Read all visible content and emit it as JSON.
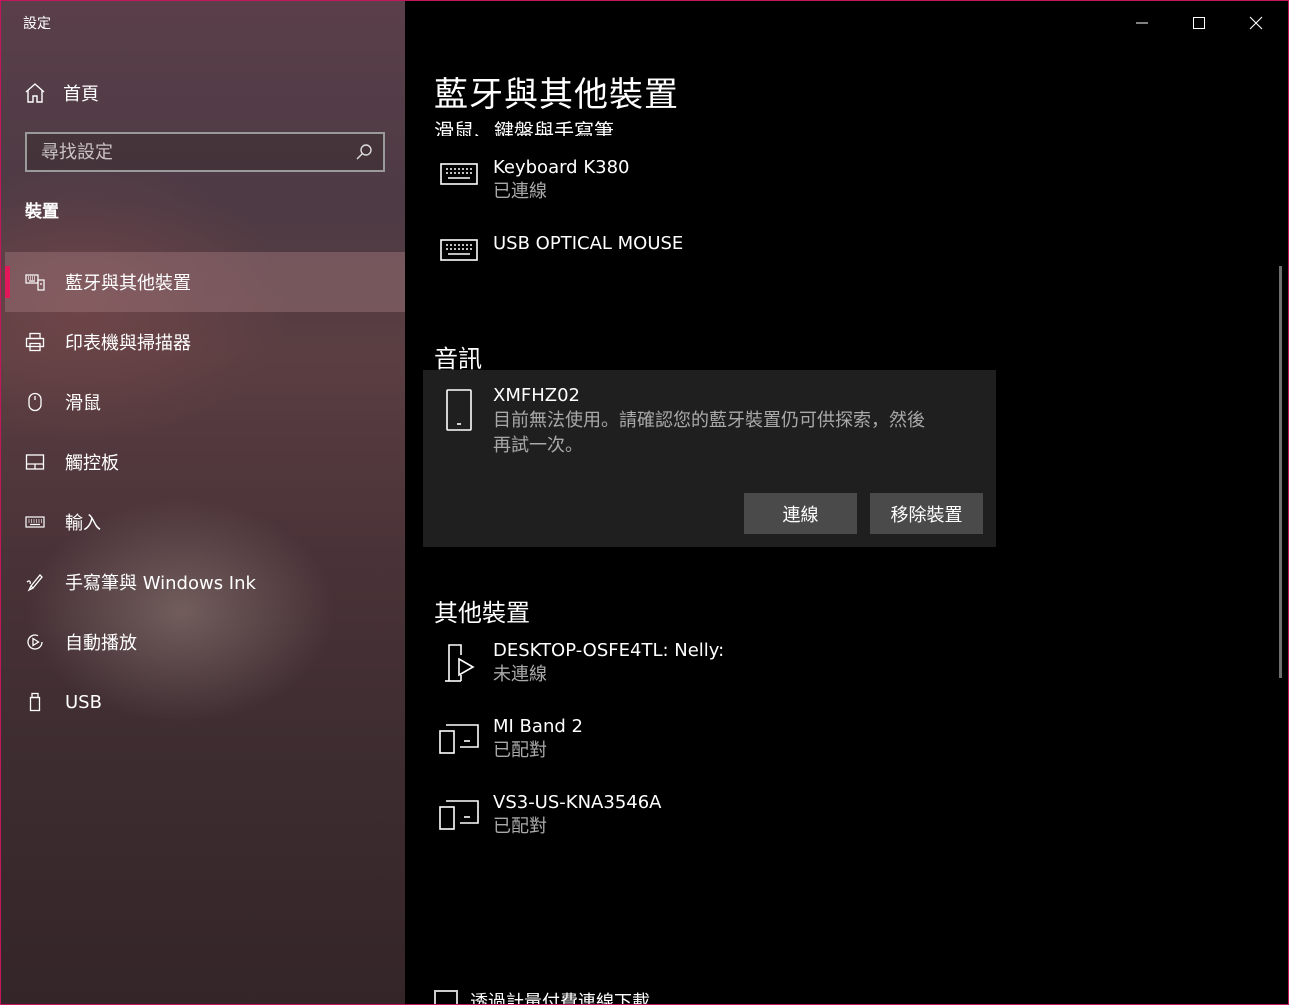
{
  "window": {
    "title": "設定"
  },
  "sidebar": {
    "home_label": "首頁",
    "search_placeholder": "尋找設定",
    "section_label": "裝置",
    "items": [
      {
        "label": "藍牙與其他裝置",
        "icon": "bluetooth-devices-icon",
        "active": true
      },
      {
        "label": "印表機與掃描器",
        "icon": "printer-icon"
      },
      {
        "label": "滑鼠",
        "icon": "mouse-icon"
      },
      {
        "label": "觸控板",
        "icon": "touchpad-icon"
      },
      {
        "label": "輸入",
        "icon": "keyboard-icon"
      },
      {
        "label": "手寫筆與 Windows Ink",
        "icon": "pen-icon"
      },
      {
        "label": "自動播放",
        "icon": "autoplay-icon"
      },
      {
        "label": "USB",
        "icon": "usb-icon"
      }
    ]
  },
  "main": {
    "page_title": "藍牙與其他裝置",
    "clipped_heading": "滑鼠、鍵盤與手寫筆",
    "input_devices": [
      {
        "name": "Keyboard K380",
        "status": "已連線",
        "icon": "keyboard-icon"
      },
      {
        "name": "USB OPTICAL MOUSE",
        "status": "",
        "icon": "keyboard-icon"
      }
    ],
    "audio": {
      "title": "音訊",
      "device_name": "XMFHZ02",
      "message": "目前無法使用。請確認您的藍牙裝置仍可供探索，然後再試一次。",
      "connect_label": "連線",
      "remove_label": "移除裝置",
      "icon": "phone-icon"
    },
    "other": {
      "title": "其他裝置",
      "devices": [
        {
          "name": "DESKTOP-OSFE4TL: Nelly:",
          "status": "未連線",
          "icon": "media-device-icon"
        },
        {
          "name": "MI Band 2",
          "status": "已配對",
          "icon": "generic-device-icon"
        },
        {
          "name": "VS3-US-KNA3546A",
          "status": "已配對",
          "icon": "generic-device-icon"
        }
      ]
    },
    "metered_checkbox_label": "透過計量付費連線下載"
  }
}
